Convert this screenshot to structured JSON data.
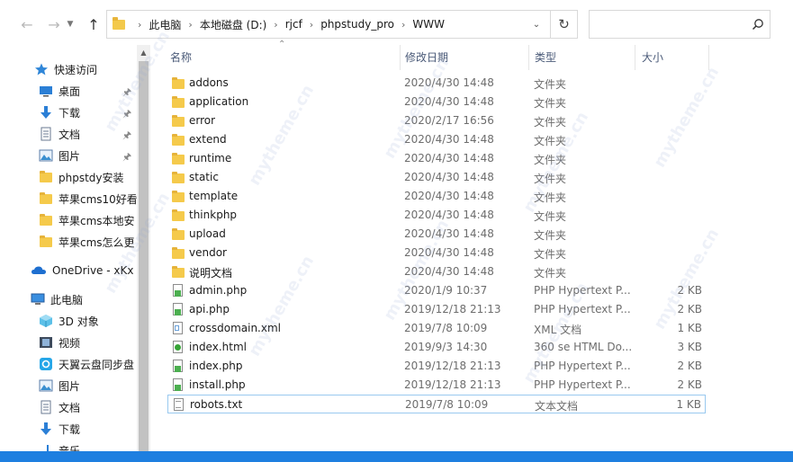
{
  "nav": {
    "back_icon": "back-arrow-icon",
    "forward_icon": "forward-arrow-icon",
    "recent_icon": "chevron-down-icon",
    "up_icon": "up-arrow-icon"
  },
  "address": {
    "crumbs": [
      "此电脑",
      "本地磁盘 (D:)",
      "rjcf",
      "phpstudy_pro",
      "WWW"
    ]
  },
  "search": {
    "placeholder": ""
  },
  "sidebar": {
    "items": [
      {
        "label": "快速访问",
        "icon": "star-icon"
      },
      {
        "label": "桌面",
        "icon": "desktop-icon",
        "pinned": true
      },
      {
        "label": "下载",
        "icon": "download-icon",
        "pinned": true
      },
      {
        "label": "文档",
        "icon": "document-icon",
        "pinned": true
      },
      {
        "label": "图片",
        "icon": "picture-icon",
        "pinned": true
      },
      {
        "label": "phpstdy安装",
        "icon": "folder-icon"
      },
      {
        "label": "苹果cms10好看",
        "icon": "folder-icon"
      },
      {
        "label": "苹果cms本地安",
        "icon": "folder-icon"
      },
      {
        "label": "苹果cms怎么更",
        "icon": "folder-icon"
      },
      {
        "label": "OneDrive - xKx",
        "icon": "cloud-icon"
      },
      {
        "label": "此电脑",
        "icon": "computer-icon"
      },
      {
        "label": "3D 对象",
        "icon": "cube-icon"
      },
      {
        "label": "视频",
        "icon": "video-icon"
      },
      {
        "label": "天翼云盘同步盘",
        "icon": "sync-icon"
      },
      {
        "label": "图片",
        "icon": "picture-icon"
      },
      {
        "label": "文档",
        "icon": "document-icon"
      },
      {
        "label": "下载",
        "icon": "download-icon"
      },
      {
        "label": "音乐",
        "icon": "music-icon"
      }
    ]
  },
  "columns": {
    "name": "名称",
    "date": "修改日期",
    "type": "类型",
    "size": "大小"
  },
  "files": [
    {
      "name": "addons",
      "date": "2020/4/30 14:48",
      "type": "文件夹",
      "size": "",
      "kind": "folder"
    },
    {
      "name": "application",
      "date": "2020/4/30 14:48",
      "type": "文件夹",
      "size": "",
      "kind": "folder"
    },
    {
      "name": "error",
      "date": "2020/2/17 16:56",
      "type": "文件夹",
      "size": "",
      "kind": "folder"
    },
    {
      "name": "extend",
      "date": "2020/4/30 14:48",
      "type": "文件夹",
      "size": "",
      "kind": "folder"
    },
    {
      "name": "runtime",
      "date": "2020/4/30 14:48",
      "type": "文件夹",
      "size": "",
      "kind": "folder"
    },
    {
      "name": "static",
      "date": "2020/4/30 14:48",
      "type": "文件夹",
      "size": "",
      "kind": "folder"
    },
    {
      "name": "template",
      "date": "2020/4/30 14:48",
      "type": "文件夹",
      "size": "",
      "kind": "folder"
    },
    {
      "name": "thinkphp",
      "date": "2020/4/30 14:48",
      "type": "文件夹",
      "size": "",
      "kind": "folder"
    },
    {
      "name": "upload",
      "date": "2020/4/30 14:48",
      "type": "文件夹",
      "size": "",
      "kind": "folder"
    },
    {
      "name": "vendor",
      "date": "2020/4/30 14:48",
      "type": "文件夹",
      "size": "",
      "kind": "folder"
    },
    {
      "name": "说明文档",
      "date": "2020/4/30 14:48",
      "type": "文件夹",
      "size": "",
      "kind": "folder"
    },
    {
      "name": "admin.php",
      "date": "2020/1/9 10:37",
      "type": "PHP Hypertext P...",
      "size": "2 KB",
      "kind": "php"
    },
    {
      "name": "api.php",
      "date": "2019/12/18 21:13",
      "type": "PHP Hypertext P...",
      "size": "2 KB",
      "kind": "php"
    },
    {
      "name": "crossdomain.xml",
      "date": "2019/7/8 10:09",
      "type": "XML 文档",
      "size": "1 KB",
      "kind": "xml"
    },
    {
      "name": "index.html",
      "date": "2019/9/3 14:30",
      "type": "360 se HTML Do...",
      "size": "3 KB",
      "kind": "html"
    },
    {
      "name": "index.php",
      "date": "2019/12/18 21:13",
      "type": "PHP Hypertext P...",
      "size": "2 KB",
      "kind": "php"
    },
    {
      "name": "install.php",
      "date": "2019/12/18 21:13",
      "type": "PHP Hypertext P...",
      "size": "2 KB",
      "kind": "php"
    },
    {
      "name": "robots.txt",
      "date": "2019/7/8 10:09",
      "type": "文本文档",
      "size": "1 KB",
      "kind": "txt",
      "selected": true
    }
  ],
  "watermark": "mytheme.cn"
}
